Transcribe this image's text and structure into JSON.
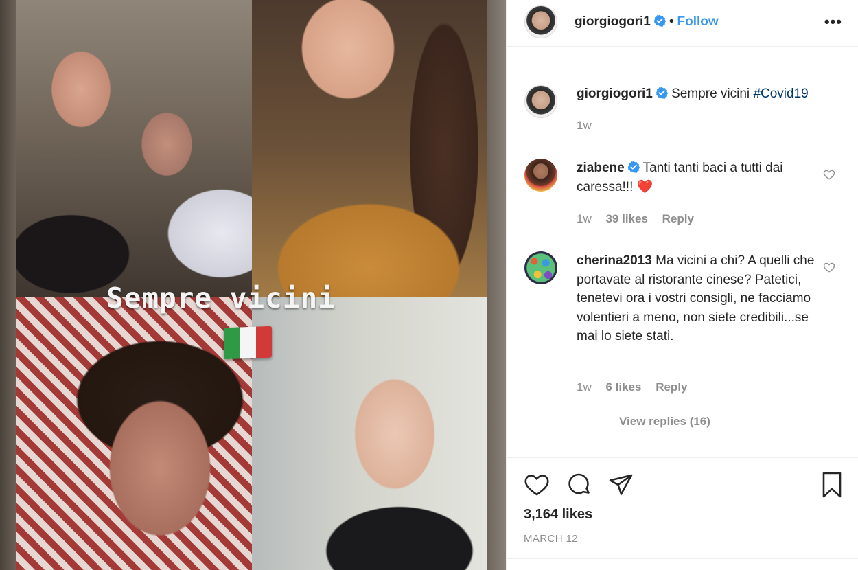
{
  "photo": {
    "caption": "Sempre vicini",
    "flag_colors": [
      "#2f9a45",
      "#f5f5f5",
      "#d23a3a"
    ]
  },
  "header": {
    "username": "giorgiogori1",
    "verified_icon": "verified-badge-icon",
    "separator": "•",
    "follow_label": "Follow",
    "more_label": "•••"
  },
  "post_caption": {
    "username": "giorgiogori1",
    "text": "Sempre vicini",
    "hashtag": "#Covid19",
    "time": "1w"
  },
  "comments": [
    {
      "username": "ziabene",
      "verified": true,
      "text": "Tanti tanti baci a tutti dai caressa!!! ❤️",
      "time": "1w",
      "likes": "39 likes",
      "reply_label": "Reply"
    },
    {
      "username": "cherina2013",
      "verified": false,
      "text": "Ma vicini a chi? A quelli che portavate al ristorante cinese? Patetici, tenetevi ora i vostri consigli, ne facciamo volentieri a meno, non siete credibili...se mai lo siete stati.",
      "time": "1w",
      "likes": "6 likes",
      "reply_label": "Reply",
      "view_replies": "View replies (16)"
    }
  ],
  "actions": {
    "icons": [
      "heart-icon",
      "comment-icon",
      "share-icon",
      "bookmark-icon"
    ],
    "likes": "3,164 likes",
    "date": "MARCH 12"
  },
  "colors": {
    "link_blue": "#3897f0",
    "hashtag_navy": "#00376b",
    "text": "#262626",
    "muted": "#8e8e8e",
    "verified_blue": "#3897f0"
  }
}
